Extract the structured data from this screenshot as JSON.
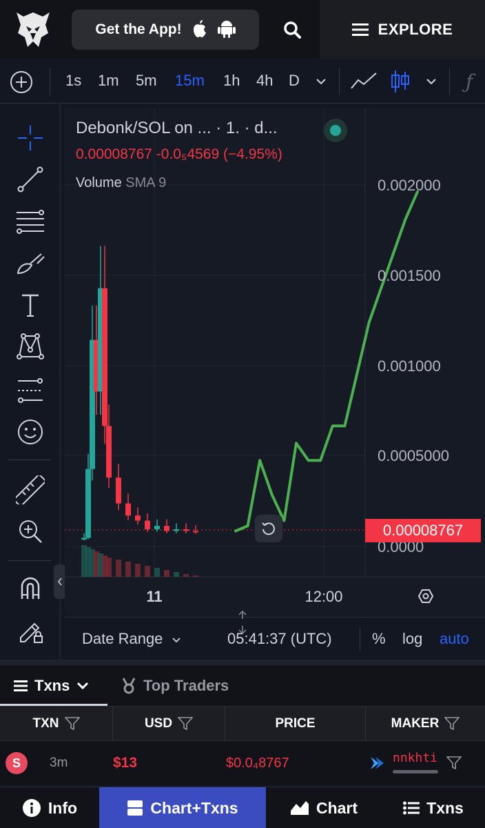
{
  "header": {
    "get_app_label": "Get the App!",
    "explore_label": "EXPLORE"
  },
  "toolbar": {
    "intervals": [
      "1s",
      "1m",
      "5m",
      "15m",
      "1h",
      "4h",
      "D"
    ],
    "active_interval": "15m"
  },
  "chart_header": {
    "title": "Debonk/SOL on ... · 1. · d...",
    "last_price": "0.00008767",
    "change": "-0.0₅4569",
    "change_pct": "(−4.95%)",
    "volume_label": "Volume",
    "volume_indicator": "SMA 9"
  },
  "chart_data": {
    "type": "line",
    "pair": "Debonk/SOL",
    "y_ticks": [
      "0.002000",
      "0.001500",
      "0.001000",
      "0.0005000",
      "0.0000"
    ],
    "ylim": [
      0,
      0.0021
    ],
    "x_ticks": [
      "11",
      "12:00"
    ],
    "current_price_label": "0.00008767",
    "candles_close_approx": [
      5e-05,
      0.00045,
      0.0012,
      0.0009,
      0.0015,
      0.0007,
      0.0004,
      0.00025,
      0.00018,
      0.00015,
      0.0001,
      0.00012,
      9e-05,
      0.0001,
      9e-05,
      8.767e-05
    ],
    "hand_drawn_projection": [
      9e-05,
      0.00012,
      0.0005,
      0.0003,
      0.00015,
      0.0006,
      0.0005,
      0.0005,
      0.0007,
      0.0007,
      0.001,
      0.0013,
      0.0015,
      0.0017,
      0.0019,
      0.00206
    ],
    "colors": {
      "up": "#26a69a",
      "down": "#f23645",
      "projection": "#4caf50"
    }
  },
  "chart_footer": {
    "date_range_label": "Date Range",
    "clock": "05:41:37 (UTC)",
    "percent_label": "%",
    "log_label": "log",
    "auto_label": "auto"
  },
  "tabs": {
    "txns_label": "Txns",
    "top_traders_label": "Top Traders"
  },
  "table": {
    "headers": {
      "txn": "TXN",
      "usd": "USD",
      "price": "PRICE",
      "maker": "MAKER"
    },
    "rows": [
      {
        "type_badge": "S",
        "age": "3m",
        "usd": "$13",
        "price": "$0.0₄8767",
        "maker": "nnkhti"
      }
    ]
  },
  "bottom_nav": {
    "info": "Info",
    "chart_txns": "Chart+Txns",
    "chart": "Chart",
    "txns": "Txns"
  }
}
